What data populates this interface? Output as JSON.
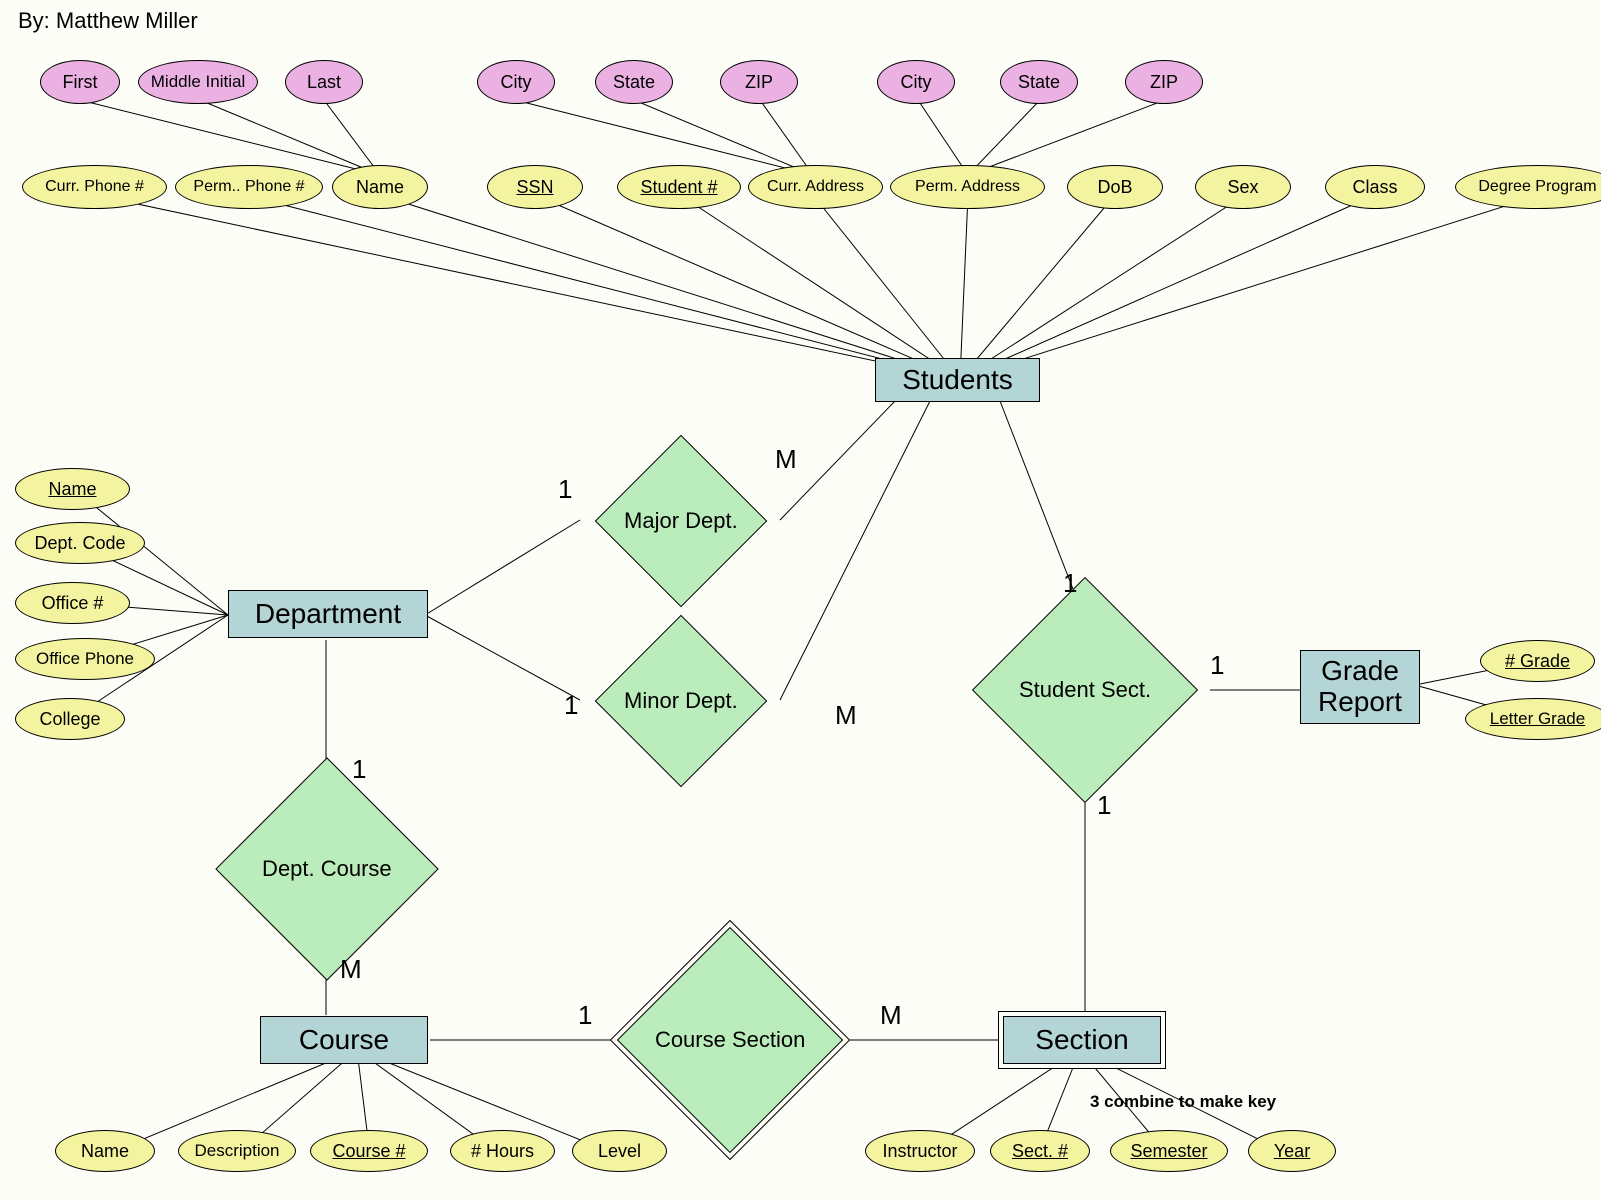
{
  "author": "By: Matthew Miller",
  "entities": {
    "students": "Students",
    "department": "Department",
    "course": "Course",
    "section": "Section",
    "gradeReport": "Grade Report"
  },
  "relationships": {
    "majorDept": "Major Dept.",
    "minorDept": "Minor Dept.",
    "studentSect": "Student Sect.",
    "deptCourse": "Dept. Course",
    "courseSection": "Course Section"
  },
  "studentAttrs": {
    "currPhone": "Curr. Phone #",
    "permPhone": "Perm.. Phone #",
    "name": "Name",
    "ssn": "SSN",
    "studentNum": "Student #",
    "currAddress": "Curr. Address",
    "permAddress": "Perm. Address",
    "dob": "DoB",
    "sex": "Sex",
    "class": "Class",
    "degreeProgram": "Degree Program"
  },
  "nameSub": {
    "first": "First",
    "middle": "Middle Initial",
    "last": "Last"
  },
  "currAddrSub": {
    "city": "City",
    "state": "State",
    "zip": "ZIP"
  },
  "permAddrSub": {
    "city": "City",
    "state": "State",
    "zip": "ZIP"
  },
  "deptAttrs": {
    "name": "Name",
    "code": "Dept. Code",
    "office": "Office #",
    "phone": "Office Phone",
    "college": "College"
  },
  "courseAttrs": {
    "name": "Name",
    "desc": "Description",
    "courseNum": "Course #",
    "hours": "# Hours",
    "level": "Level"
  },
  "sectionAttrs": {
    "instructor": "Instructor",
    "sectNum": "Sect. #",
    "semester": "Semester",
    "year": "Year"
  },
  "gradeAttrs": {
    "numGrade": "# Grade",
    "letterGrade": "Letter Grade"
  },
  "cardinalities": {
    "major_dept": "1",
    "major_stud": "M",
    "minor_dept": "1",
    "minor_stud": "M",
    "deptcourse_dept": "1",
    "deptcourse_course": "M",
    "coursesect_course": "1",
    "coursesect_sect": "M",
    "studsect_stud": "1",
    "studsect_sect": "1",
    "studsect_grade": "1"
  },
  "note": "3 combine to make key"
}
